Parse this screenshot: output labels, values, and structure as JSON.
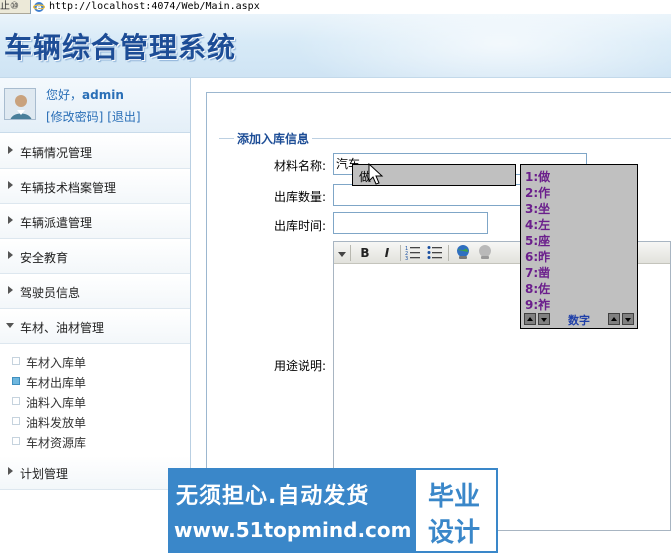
{
  "browser": {
    "address_prefix": "止⑩",
    "url": "http://localhost:4074/Web/Main.aspx"
  },
  "banner": {
    "title": "车辆综合管理系统"
  },
  "user": {
    "greeting_prefix": "您好，",
    "username": "admin",
    "change_password": "[修改密码]",
    "logout": "[退出]"
  },
  "nav": {
    "items": [
      {
        "label": "车辆情况管理"
      },
      {
        "label": "车辆技术档案管理"
      },
      {
        "label": "车辆派遣管理"
      },
      {
        "label": "安全教育"
      },
      {
        "label": "驾驶员信息"
      },
      {
        "label": "车材、油材管理"
      },
      {
        "label": "计划管理"
      }
    ],
    "sub_items": [
      {
        "label": "车材入库单"
      },
      {
        "label": "车材出库单"
      },
      {
        "label": "油料入库单"
      },
      {
        "label": "油料发放单"
      },
      {
        "label": "车材资源库"
      }
    ]
  },
  "form": {
    "legend": "添加入库信息",
    "material_label": "材料名称:",
    "material_value": "汽车",
    "quantity_label": "出库数量:",
    "quantity_value": "",
    "time_label": "出库时间:",
    "time_value": "",
    "usage_label": "用途说明:"
  },
  "editor": {
    "bold": "B",
    "italic": "I"
  },
  "ime": {
    "composition": "做",
    "candidates": [
      "1:做",
      "2:作",
      "3:坐",
      "4:左",
      "5:座",
      "6:昨",
      "7:凿",
      "8:佐",
      "9:祚"
    ],
    "mode": "数字"
  },
  "watermark": {
    "line1": "无须担心.自动发货",
    "line2": "www.51topmind.com",
    "right1": "毕业",
    "right2": "设计",
    "color": "#3a87c9"
  }
}
